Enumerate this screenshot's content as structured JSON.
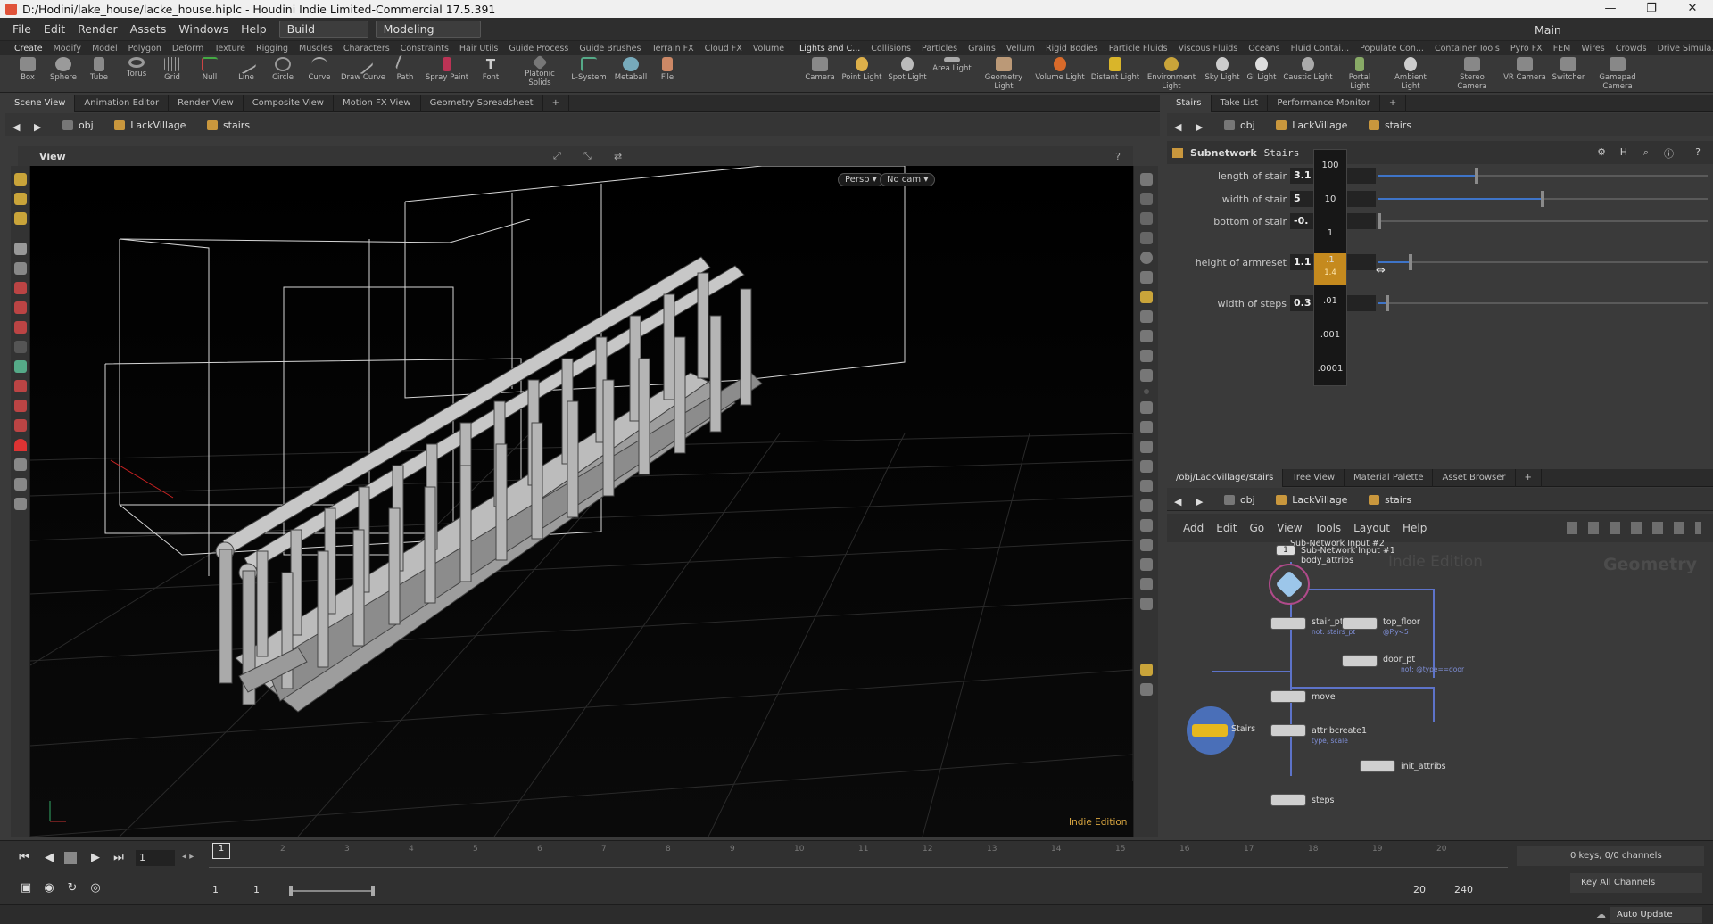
{
  "window": {
    "title": "D:/Hodini/lake_house/lacke_house.hiplc - Houdini Indie Limited-Commercial 17.5.391",
    "controls": [
      "—",
      "❐",
      "✕"
    ]
  },
  "menu": {
    "items": [
      "File",
      "Edit",
      "Render",
      "Assets",
      "Windows",
      "Help"
    ],
    "desktop_label": "Build",
    "context_label": "Modeling",
    "main_desk": "Main"
  },
  "shelf_tabs_left": [
    "Create",
    "Modify",
    "Model",
    "Polygon",
    "Deform",
    "Texture",
    "Rigging",
    "Muscles",
    "Characters",
    "Constraints",
    "Hair Utils",
    "Guide Process",
    "Guide Brushes",
    "Terrain FX",
    "Cloud FX",
    "Volume"
  ],
  "shelf_tabs_right": [
    "Lights and C...",
    "Collisions",
    "Particles",
    "Grains",
    "Vellum",
    "Rigid Bodies",
    "Particle Fluids",
    "Viscous Fluids",
    "Oceans",
    "Fluid Contai...",
    "Populate Con...",
    "Container Tools",
    "Pyro FX",
    "FEM",
    "Wires",
    "Crowds",
    "Drive Simula..."
  ],
  "shelf_tools_left": [
    "Box",
    "Sphere",
    "Tube",
    "Torus",
    "Grid",
    "Null",
    "Line",
    "Circle",
    "Curve",
    "Draw Curve",
    "Path",
    "Spray Paint",
    "Font",
    "Platonic Solids",
    "L-System",
    "Metaball",
    "File"
  ],
  "shelf_tools_right": [
    "Camera",
    "Point Light",
    "Spot Light",
    "Area Light",
    "Geometry Light",
    "Volume Light",
    "Distant Light",
    "Environment Light",
    "Sky Light",
    "GI Light",
    "Caustic Light",
    "Portal Light",
    "Ambient Light",
    "Stereo Camera",
    "VR Camera",
    "Switcher",
    "Gamepad Camera"
  ],
  "left_pane": {
    "tabs": [
      "Scene View",
      "Animation Editor",
      "Render View",
      "Composite View",
      "Motion FX View",
      "Geometry Spreadsheet"
    ],
    "path": [
      "obj",
      "LackVillage",
      "stairs"
    ],
    "view_label": "View",
    "persp_btn": "Persp ▾",
    "cam_btn": "No cam ▾",
    "watermark": "Indie Edition"
  },
  "param_pane": {
    "tabs": [
      "Stairs",
      "Take List",
      "Performance Monitor"
    ],
    "path": [
      "obj",
      "LackVillage",
      "stairs"
    ],
    "node_type": "Subnetwork",
    "node_name": "Stairs",
    "params": [
      {
        "label": "length of stair",
        "value": "3.1",
        "level": 0.3
      },
      {
        "label": "width of stair",
        "value": "5",
        "level": 0.5
      },
      {
        "label": "bottom of stair",
        "value": "-0.",
        "level": 0.0
      },
      {
        "label": "height of armreset",
        "value": "1.1",
        "level": 0.1
      },
      {
        "label": "width of steps",
        "value": "0.3",
        "level": 0.03
      }
    ],
    "ladder": [
      "100",
      "10",
      "1",
      ".1",
      "1.4",
      ".01",
      ".001",
      ".0001"
    ]
  },
  "network_pane": {
    "tabs": [
      "/obj/LackVillage/stairs",
      "Tree View",
      "Material Palette",
      "Asset Browser"
    ],
    "path": [
      "obj",
      "LackVillage",
      "stairs"
    ],
    "menu": [
      "Add",
      "Edit",
      "Go",
      "View",
      "Tools",
      "Layout",
      "Help"
    ],
    "watermark": "Indie Edition",
    "context_label": "Geometry",
    "nodes": [
      {
        "name": "Sub-Network Input #2",
        "sub": ""
      },
      {
        "name": "Sub-Network Input #1",
        "sub": "body_attribs"
      },
      {
        "name": "stair_pt",
        "sub": "not: stairs_pt"
      },
      {
        "name": "top_floor",
        "sub": "@P.y<5"
      },
      {
        "name": "door_pt",
        "sub": "not: @type==door"
      },
      {
        "name": "move",
        "sub": ""
      },
      {
        "name": "Stairs",
        "sub": ""
      },
      {
        "name": "attribcreate1",
        "sub": "type, scale"
      },
      {
        "name": "init_attribs",
        "sub": ""
      },
      {
        "name": "steps",
        "sub": ""
      }
    ],
    "input_index": "1"
  },
  "timeline": {
    "frame": "1",
    "ticks": [
      "1",
      "2",
      "3",
      "4",
      "5",
      "6",
      "7",
      "8",
      "9",
      "10",
      "11",
      "12",
      "13",
      "14",
      "15",
      "16",
      "17",
      "18",
      "19",
      "20"
    ],
    "range_start": "1",
    "range_start2": "1",
    "range_end": "20",
    "range_end2": "240",
    "keys_info": "0 keys, 0/0 channels",
    "key_all": "Key All Channels"
  },
  "status": {
    "auto_update": "Auto Update"
  },
  "colors": {
    "accent": "#3e74c8",
    "ladder_active": "#c58a1e",
    "node_selected": "#e6b81e"
  }
}
